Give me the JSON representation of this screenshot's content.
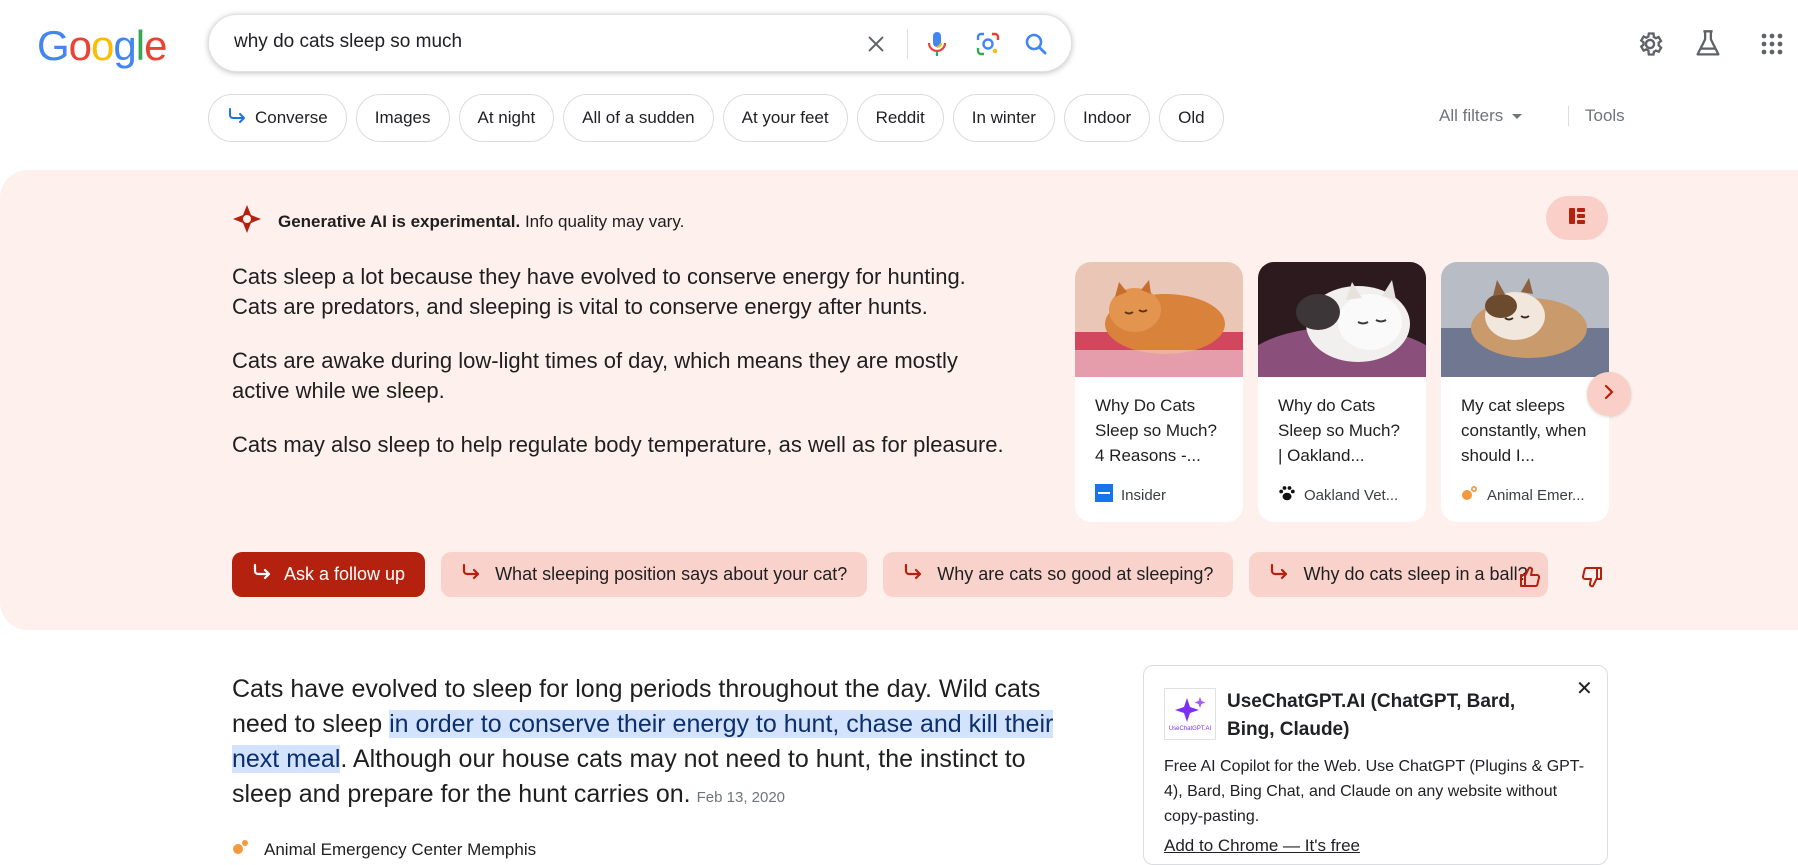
{
  "logo": {
    "letters": [
      "G",
      "o",
      "o",
      "g",
      "l",
      "e"
    ],
    "colors": [
      "#4285f4",
      "#ea4335",
      "#fbbc05",
      "#4285f4",
      "#34a853",
      "#ea4335"
    ]
  },
  "search": {
    "query": "why do cats sleep so much"
  },
  "chips": [
    {
      "label": "Converse",
      "icon": "arrow-return-icon"
    },
    {
      "label": "Images"
    },
    {
      "label": "At night"
    },
    {
      "label": "All of a sudden"
    },
    {
      "label": "At your feet"
    },
    {
      "label": "Reddit"
    },
    {
      "label": "In winter"
    },
    {
      "label": "Indoor"
    },
    {
      "label": "Old"
    }
  ],
  "filters": {
    "all_filters": "All filters",
    "tools": "Tools"
  },
  "ai": {
    "badge_bold": "Generative AI is experimental.",
    "badge_rest": "Info quality may vary.",
    "paragraphs": [
      "Cats sleep a lot because they have evolved to conserve energy for hunting. Cats are predators, and sleeping is vital to conserve energy after hunts.",
      "Cats are awake during low-light times of day, which means they are mostly active while we sleep.",
      "Cats may also sleep to help regulate body temperature, as well as for pleasure."
    ],
    "cards": [
      {
        "title": "Why Do Cats Sleep so Much? 4 Reasons -...",
        "source": "Insider"
      },
      {
        "title": "Why do Cats Sleep so Much? | Oakland...",
        "source": "Oakland Vet..."
      },
      {
        "title": "My cat sleeps constantly, when should I...",
        "source": "Animal Emer..."
      }
    ],
    "followup_main": "Ask a follow up",
    "followups": [
      "What sleeping position says about your cat?",
      "Why are cats so good at sleeping?",
      "Why do cats sleep in a ball?"
    ]
  },
  "result": {
    "snippet_a": "Cats have evolved to sleep for long periods throughout the day. Wild cats need to sleep ",
    "snippet_hl": "in order to conserve their energy to hunt, chase and kill their next meal",
    "snippet_b": ". Although our house cats may not need to hunt, the instinct to sleep and prepare for the hunt carries on.",
    "date": "Feb 13, 2020",
    "source": "Animal Emergency Center Memphis"
  },
  "extension": {
    "title": "UseChatGPT.AI (ChatGPT, Bard, Bing, Claude)",
    "logo_text": "UseChatGPT.AI",
    "description": "Free AI Copilot for the Web. Use ChatGPT (Plugins & GPT-4), Bard, Bing Chat, and Claude on any website without copy-pasting.",
    "link": "Add to Chrome — It's free",
    "close": "✕"
  },
  "colors": {
    "ai_bg": "#fdf0ed",
    "accent": "#b5210f",
    "chip_ai": "#f9d3cb",
    "highlight": "#d3e3fd"
  }
}
